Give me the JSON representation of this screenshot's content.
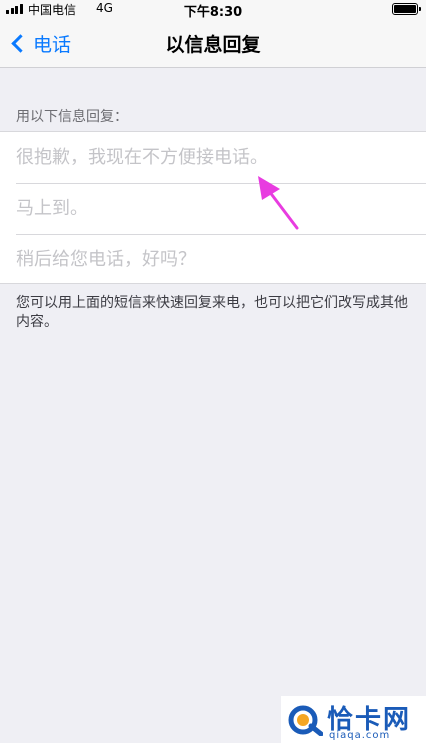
{
  "status_bar": {
    "carrier": "中国电信",
    "network": "4G",
    "time": "下午8:30"
  },
  "nav": {
    "back_label": "电话",
    "title": "以信息回复"
  },
  "section": {
    "header": "用以下信息回复：",
    "rows": [
      {
        "placeholder": "很抱歉，我现在不方便接电话。"
      },
      {
        "placeholder": "马上到。"
      },
      {
        "placeholder": "稍后给您电话，好吗？"
      }
    ],
    "footer": "您可以用上面的短信来快速回复来电，也可以把它们改写成其他内容。"
  },
  "annotation": {
    "arrow_color": "#e83ce0"
  },
  "watermark": {
    "name": "恰卡网",
    "url": "qiaqa.com",
    "color": "#1a5bb8"
  },
  "colors": {
    "accent": "#0a7aff",
    "background": "#efeff4"
  }
}
